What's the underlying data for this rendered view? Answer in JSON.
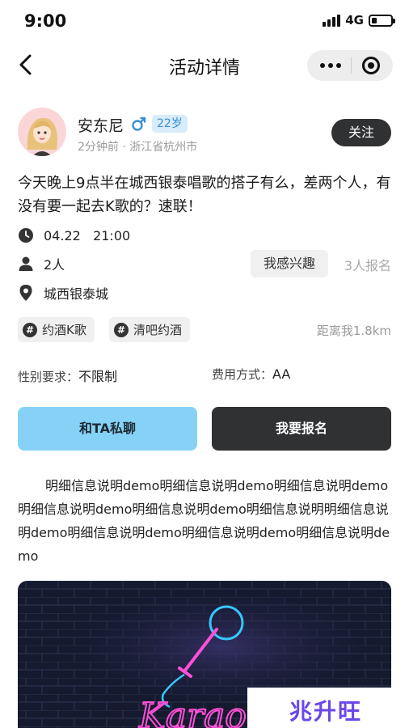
{
  "status_bar": {
    "time": "9:00",
    "network": "4G",
    "battery_level": 0.25
  },
  "nav": {
    "title": "活动详情",
    "back_icon": "chevron-left-icon",
    "more_icon": "more-dots-icon",
    "close_icon": "target-circle-icon"
  },
  "user": {
    "name": "安东尼",
    "gender_icon": "male-icon",
    "age": "22岁",
    "meta": "2分钟前 · 浙江省杭州市",
    "follow_label": "关注"
  },
  "activity": {
    "description": "今天晚上9点半在城西银泰唱歌的搭子有么，差两个人，有没有要一起去K歌的？速联！",
    "time": "04.22   21:00",
    "people": "2人",
    "interest_label": "我感兴趣",
    "signup_count": "3人报名",
    "location": "城西银泰城",
    "tags": [
      "约酒K歌",
      "清吧约酒"
    ],
    "distance": "距离我1.8km",
    "gender_req_label": "性别要求：",
    "gender_req_value": "不限制",
    "fee_label": "费用方式：",
    "fee_value": "AA"
  },
  "actions": {
    "chat_label": "和TA私聊",
    "join_label": "我要报名"
  },
  "detail_text": "明细信息说明demo明细信息说明demo明细信息说明demo明细信息说明demo明细信息说明demo明细信息说明明细信息说明demo明细信息说明demo明细信息说明demo明细信息说明demo",
  "poster": {
    "neon_text": "Karaoke",
    "icon": "microphone-icon"
  },
  "watermark": {
    "text": "兆升旺"
  },
  "colors": {
    "accent_blue": "#86d2f7",
    "dark_button": "#2f3133",
    "badge_blue": "#3a8fd8",
    "neon_pink": "#ff4fd8",
    "neon_cyan": "#36c8ff"
  }
}
